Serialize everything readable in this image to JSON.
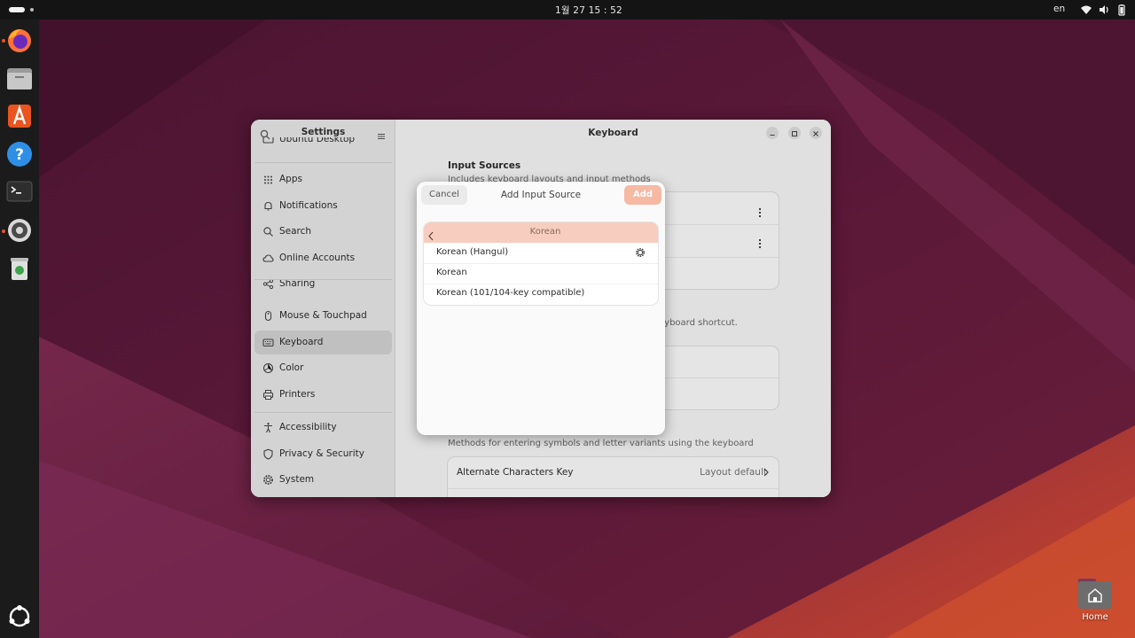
{
  "topbar": {
    "clock": "1월 27  15 : 52",
    "input_language": "en"
  },
  "dock": {
    "items": [
      "firefox-icon",
      "files-icon",
      "app-center-icon",
      "help-icon",
      "terminal-icon",
      "settings-icon",
      "trash-icon",
      "show-apps-icon"
    ]
  },
  "settings": {
    "sidebar_title": "Settings",
    "partial_item": "Ubuntu Desktop",
    "groups": [
      [
        {
          "label": "Apps",
          "icon": "apps-icon"
        },
        {
          "label": "Notifications",
          "icon": "bell-icon"
        },
        {
          "label": "Search",
          "icon": "search-icon"
        },
        {
          "label": "Online Accounts",
          "icon": "cloud-icon"
        },
        {
          "label": "Sharing",
          "icon": "share-icon"
        }
      ],
      [
        {
          "label": "Mouse & Touchpad",
          "icon": "mouse-icon"
        },
        {
          "label": "Keyboard",
          "icon": "keyboard-icon",
          "active": true
        },
        {
          "label": "Color",
          "icon": "color-icon"
        },
        {
          "label": "Printers",
          "icon": "printer-icon"
        }
      ],
      [
        {
          "label": "Accessibility",
          "icon": "accessibility-icon"
        },
        {
          "label": "Privacy & Security",
          "icon": "privacy-icon"
        },
        {
          "label": "System",
          "icon": "system-gear-icon"
        }
      ]
    ],
    "content_title": "Keyboard",
    "input_sources": {
      "title": "Input Sources",
      "subtitle": "Includes keyboard layouts and input methods"
    },
    "partial_text_1": "eyboard shortcut.",
    "partial_text_2": "w",
    "special_chars_subtitle": "Methods for entering symbols and letter variants using the keyboard",
    "alternate_chars": {
      "label": "Alternate Characters Key",
      "value": "Layout default"
    }
  },
  "dialog": {
    "cancel_label": "Cancel",
    "title": "Add Input Source",
    "add_label": "Add",
    "header": "Korean",
    "options": [
      "Korean (Hangul)",
      "Korean",
      "Korean (101/104-key compatible)"
    ]
  },
  "desktop": {
    "home_label": "Home"
  },
  "colors": {
    "accent": "#e95420",
    "selected_header": "#f7cdbf",
    "add_button": "#f5b9a4"
  }
}
